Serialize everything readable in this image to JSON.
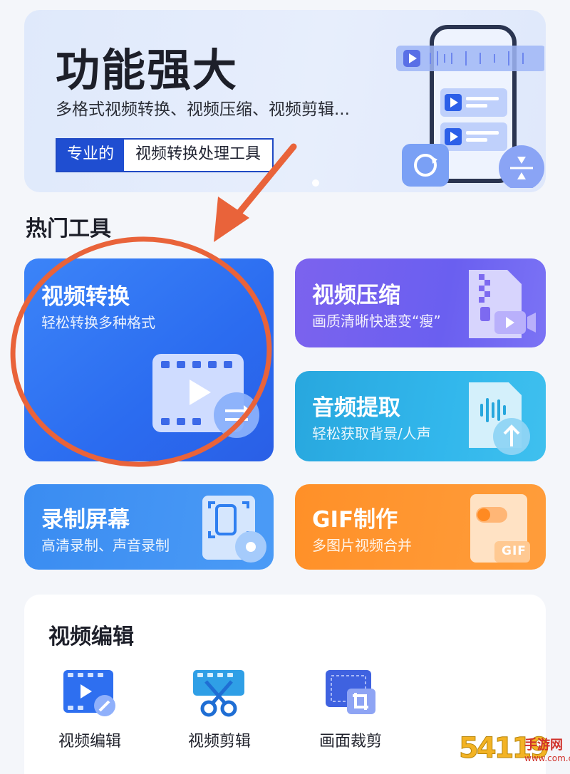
{
  "banner": {
    "title": "功能强大",
    "subtitle": "多格式视频转换、视频压缩、视频剪辑...",
    "tag_primary": "专业的",
    "tag_secondary": "视频转换处理工具"
  },
  "hot_tools": {
    "title": "热门工具",
    "items": [
      {
        "title": "视频转换",
        "subtitle": "轻松转换多种格式"
      },
      {
        "title": "视频压缩",
        "subtitle": "画质清晰快速变“瘦”"
      },
      {
        "title": "音频提取",
        "subtitle": "轻松获取背景/人声"
      },
      {
        "title": "录制屏幕",
        "subtitle": "高清录制、声音录制"
      },
      {
        "title": "GIF制作",
        "subtitle": "多图片视频合并",
        "badge": "GIF"
      }
    ]
  },
  "video_edit": {
    "title": "视频编辑",
    "items": [
      {
        "label": "视频编辑"
      },
      {
        "label": "视频剪辑"
      },
      {
        "label": "画面裁剪"
      }
    ]
  },
  "watermark": {
    "text_main": "54119",
    "text_side": "手游网",
    "text_url": "www.com.cn"
  },
  "colors": {
    "accent_blue": "#2b6cf0",
    "annotation": "#e9633a",
    "gif_orange": "#ff9028"
  }
}
